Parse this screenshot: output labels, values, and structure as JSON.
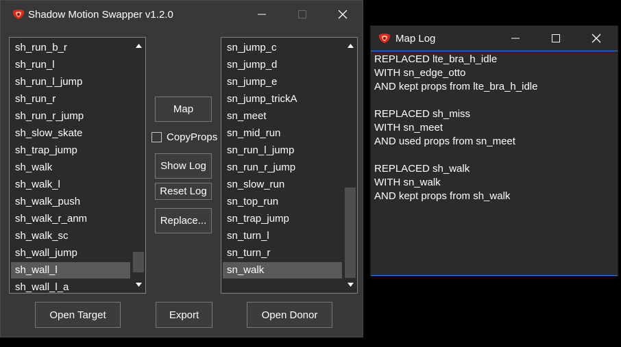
{
  "main_window": {
    "title": "Shadow Motion Swapper v1.2.0",
    "target_list": {
      "items": [
        "sh_run_b_r",
        "sh_run_l",
        "sh_run_l_jump",
        "sh_run_r",
        "sh_run_r_jump",
        "sh_slow_skate",
        "sh_trap_jump",
        "sh_walk",
        "sh_walk_l",
        "sh_walk_push",
        "sh_walk_r_anm",
        "sh_walk_sc",
        "sh_wall_jump",
        "sh_wall_l",
        "sh_wall_l_a"
      ],
      "selected": "sh_wall_l",
      "scroll_position": 0.93
    },
    "donor_list": {
      "items": [
        "sn_jump_c",
        "sn_jump_d",
        "sn_jump_e",
        "sn_jump_trickA",
        "sn_meet",
        "sn_mid_run",
        "sn_run_l_jump",
        "sn_run_r_jump",
        "sn_slow_run",
        "sn_top_run",
        "sn_trap_jump",
        "sn_turn_l",
        "sn_turn_r",
        "sn_walk"
      ],
      "selected": "sn_walk",
      "scroll_position": 1.0
    },
    "buttons": {
      "map": "Map",
      "copy_props": "CopyProps",
      "show_log": "Show Log",
      "reset_log": "Reset Log",
      "replace": "Replace...",
      "open_target": "Open Target",
      "export": "Export",
      "open_donor": "Open Donor"
    },
    "copy_props_checked": false
  },
  "log_window": {
    "title": "Map Log",
    "lines": [
      "REPLACED lte_bra_h_idle",
      "WITH sn_edge_otto",
      "AND kept props from lte_bra_h_idle",
      "",
      "REPLACED sh_miss",
      "WITH sn_meet",
      "AND used props from sn_meet",
      "",
      "REPLACED sh_walk",
      "WITH sn_walk",
      "AND kept props from sh_walk"
    ]
  },
  "icons": [
    "app-icon",
    "minimize-icon",
    "maximize-icon",
    "close-icon",
    "scroll-up-icon",
    "scroll-down-icon"
  ],
  "colors": {
    "window_bg": "#383838",
    "list_bg": "#2b2b2b",
    "selection": "#5a5a5a",
    "accent": "#2f7fd1",
    "app_icon": "#d62b1f"
  }
}
